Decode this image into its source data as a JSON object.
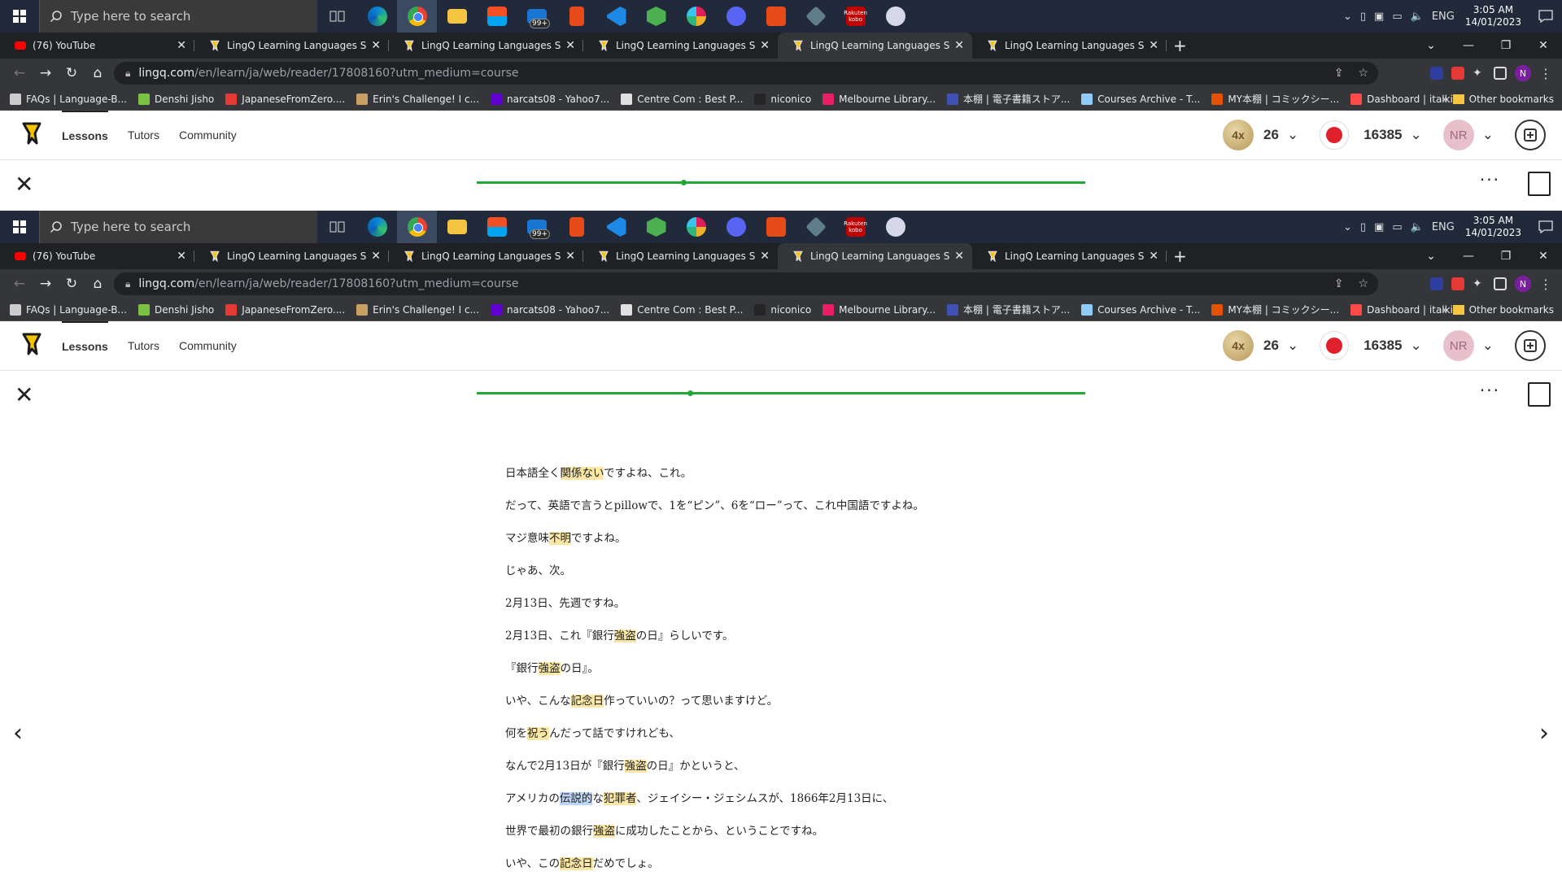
{
  "taskbar": {
    "search_placeholder": "Type here to search",
    "mail_badge": "99+",
    "kobo_label": "Rakuten kobo",
    "language": "ENG",
    "time": "3:05 AM",
    "date": "14/01/2023"
  },
  "tabs": [
    {
      "title": "(76) YouTube",
      "icon": "youtube-icon"
    },
    {
      "title": "LingQ Learning Languages Simpl",
      "icon": "lingq-icon"
    },
    {
      "title": "LingQ Learning Languages Simpl",
      "icon": "lingq-icon"
    },
    {
      "title": "LingQ Learning Languages Simpl",
      "icon": "lingq-icon"
    },
    {
      "title": "LingQ Learning Languages Simpl",
      "icon": "lingq-icon"
    },
    {
      "title": "LingQ Learning Languages Simpl",
      "icon": "lingq-icon"
    }
  ],
  "omnibox": {
    "host": "lingq.com",
    "path": "/en/learn/ja/web/reader/17808160?utm_medium=course",
    "profile_initial": "N"
  },
  "bookmarks": [
    {
      "label": "FAQs | Language-B...",
      "color": "#cccccc"
    },
    {
      "label": "Denshi Jisho",
      "color": "#7bc142"
    },
    {
      "label": "JapaneseFromZero....",
      "color": "#e53935"
    },
    {
      "label": "Erin's Challenge! I c...",
      "color": "#c9a063"
    },
    {
      "label": "narcats08 - Yahoo7...",
      "color": "#6001d2"
    },
    {
      "label": "Centre Com : Best P...",
      "color": "#e0e0e0"
    },
    {
      "label": "niconico",
      "color": "#252525"
    },
    {
      "label": "Melbourne Library...",
      "color": "#e91e63"
    },
    {
      "label": "本棚 | 電子書籍ストア...",
      "color": "#3f51b5"
    },
    {
      "label": "Courses Archive - T...",
      "color": "#90caf9"
    },
    {
      "label": "MY本棚 | コミックシー...",
      "color": "#e65100"
    },
    {
      "label": "Dashboard | italki",
      "color": "#ff4a4a"
    }
  ],
  "bookmarks_more": "»",
  "bookmarks_other": "Other bookmarks",
  "lingq_nav": {
    "lessons": "Lessons",
    "tutors": "Tutors",
    "community": "Community",
    "coin_multiplier": "4x",
    "streak": "26",
    "known_words": "16385",
    "user_initials": "NR"
  },
  "reader": {
    "progress_percent": 35,
    "lines": [
      [
        {
          "t": "日本語全く"
        },
        {
          "t": "関係ない",
          "h": "y"
        },
        {
          "t": "ですよね、これ。"
        }
      ],
      [
        {
          "t": "だって、英語で言うとpillowで、1を“ピン”、6を“ロー”って、これ中国語ですよね。"
        }
      ],
      [
        {
          "t": "マジ意味"
        },
        {
          "t": "不明",
          "h": "y"
        },
        {
          "t": "ですよね。"
        }
      ],
      [
        {
          "t": "じゃあ、次。"
        }
      ],
      [
        {
          "t": "2月13日、先週ですね。"
        }
      ],
      [
        {
          "t": "2月13日、これ『銀行"
        },
        {
          "t": "強盗",
          "h": "y"
        },
        {
          "t": "の日』らしいです。"
        }
      ],
      [
        {
          "t": "『銀行"
        },
        {
          "t": "強盗",
          "h": "y"
        },
        {
          "t": "の日』。"
        }
      ],
      [
        {
          "t": "いや、こんな"
        },
        {
          "t": "記念日",
          "h": "y"
        },
        {
          "t": "作っていいの？って思いますけど。"
        }
      ],
      [
        {
          "t": "何を"
        },
        {
          "t": "祝う",
          "h": "y"
        },
        {
          "t": "んだって話ですけれども、"
        }
      ],
      [
        {
          "t": "なんで2月13日が『銀行"
        },
        {
          "t": "強盗",
          "h": "y"
        },
        {
          "t": "の日』かというと、"
        }
      ],
      [
        {
          "t": "アメリカの"
        },
        {
          "t": "伝説的",
          "h": "b"
        },
        {
          "t": "な"
        },
        {
          "t": "犯罪者",
          "h": "y"
        },
        {
          "t": "、ジェイシー・ジェシムスが、1866年2月13日に、"
        }
      ],
      [
        {
          "t": "世界で最初の銀行"
        },
        {
          "t": "強盗",
          "h": "y"
        },
        {
          "t": "に成功したことから、ということですね。"
        }
      ],
      [
        {
          "t": "いや、この"
        },
        {
          "t": "記念日",
          "h": "y"
        },
        {
          "t": "だめでしょ。"
        }
      ]
    ]
  }
}
